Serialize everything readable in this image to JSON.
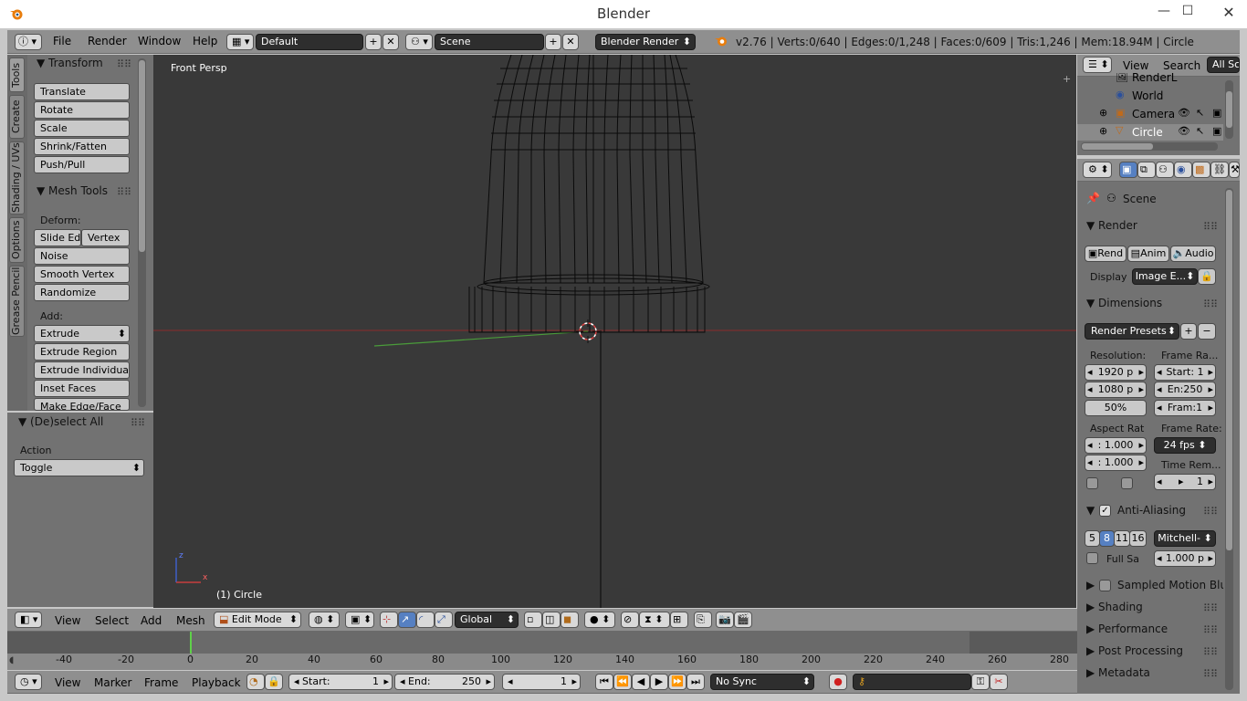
{
  "window": {
    "title": "Blender",
    "minimize": "—",
    "maximize": "☐",
    "close": "✕"
  },
  "info_header": {
    "menus": [
      "File",
      "Render",
      "Window",
      "Help"
    ],
    "layout": "Default",
    "scene": "Scene",
    "engine": "Blender Render",
    "stats": "v2.76 | Verts:0/640 | Edges:0/1,248 | Faces:0/609 | Tris:1,246 | Mem:18.94M | Circle"
  },
  "tool_tabs": [
    "Tools",
    "Create",
    "Shading / UVs",
    "Options",
    "Grease Pencil"
  ],
  "tools": {
    "transform_title": "Transform",
    "transform": [
      "Translate",
      "Rotate",
      "Scale",
      "Shrink/Fatten",
      "Push/Pull"
    ],
    "mesh_tools_title": "Mesh Tools",
    "deform_label": "Deform:",
    "slide_edge": "Slide Ed",
    "vertex": "Vertex",
    "deform": [
      "Noise",
      "Smooth Vertex",
      "Randomize"
    ],
    "add_label": "Add:",
    "extrude": "Extrude",
    "add": [
      "Extrude Region",
      "Extrude Individual",
      "Inset Faces",
      "Make Edge/Face"
    ]
  },
  "operator": {
    "title": "(De)select All",
    "action_label": "Action",
    "action_value": "Toggle"
  },
  "viewport": {
    "view_label": "Front Persp",
    "object_label": "(1) Circle",
    "axis_z": "z",
    "axis_x": "x"
  },
  "view3d_header": {
    "menus": [
      "View",
      "Select",
      "Add",
      "Mesh"
    ],
    "mode": "Edit Mode",
    "orientation": "Global"
  },
  "timeline": {
    "ticks": [
      "-40",
      "-20",
      "0",
      "20",
      "40",
      "60",
      "80",
      "100",
      "120",
      "140",
      "160",
      "180",
      "200",
      "220",
      "240",
      "260",
      "280"
    ],
    "menus": [
      "View",
      "Marker",
      "Frame",
      "Playback"
    ],
    "start_label": "Start:",
    "start_value": "1",
    "end_label": "End:",
    "end_value": "250",
    "current": "1",
    "sync": "No Sync"
  },
  "outliner": {
    "menus": [
      "View",
      "Search"
    ],
    "filter": "All Sc",
    "items": [
      {
        "label": "RenderL",
        "icon": "render-layers-icon"
      },
      {
        "label": "World",
        "icon": "world-icon"
      },
      {
        "label": "Camera",
        "icon": "camera-icon"
      },
      {
        "label": "Circle",
        "icon": "mesh-icon"
      }
    ]
  },
  "properties": {
    "context": "Scene",
    "render_title": "Render",
    "render_btn": "Rend",
    "anim_btn": "Anim",
    "audio_btn": "Audio",
    "display_label": "Display",
    "display_value": "Image E...",
    "dimensions_title": "Dimensions",
    "render_presets": "Render Presets",
    "resolution_label": "Resolution:",
    "res_x": "1920 p",
    "res_y": "1080 p",
    "res_pct": "50%",
    "frame_range_label": "Frame Ra...",
    "frame_start": "Start: 1",
    "frame_end": "En:250",
    "frame_step": "Fram:1",
    "aspect_label": "Aspect Rat",
    "aspect_x": ": 1.000",
    "aspect_y": ": 1.000",
    "frame_rate_label": "Frame Rate:",
    "frame_rate": "24 fps",
    "time_remap_label": "Time Rem...",
    "time_remap_value": "1",
    "aa_title": "Anti-Aliasing",
    "aa_samples": [
      "5",
      "8",
      "11",
      "16"
    ],
    "aa_filter": "Mitchell-",
    "full_sample": "Full Sa",
    "filter_size": "1.000 p",
    "collapsed": [
      "Sampled Motion Blur",
      "Shading",
      "Performance",
      "Post Processing",
      "Metadata"
    ]
  }
}
